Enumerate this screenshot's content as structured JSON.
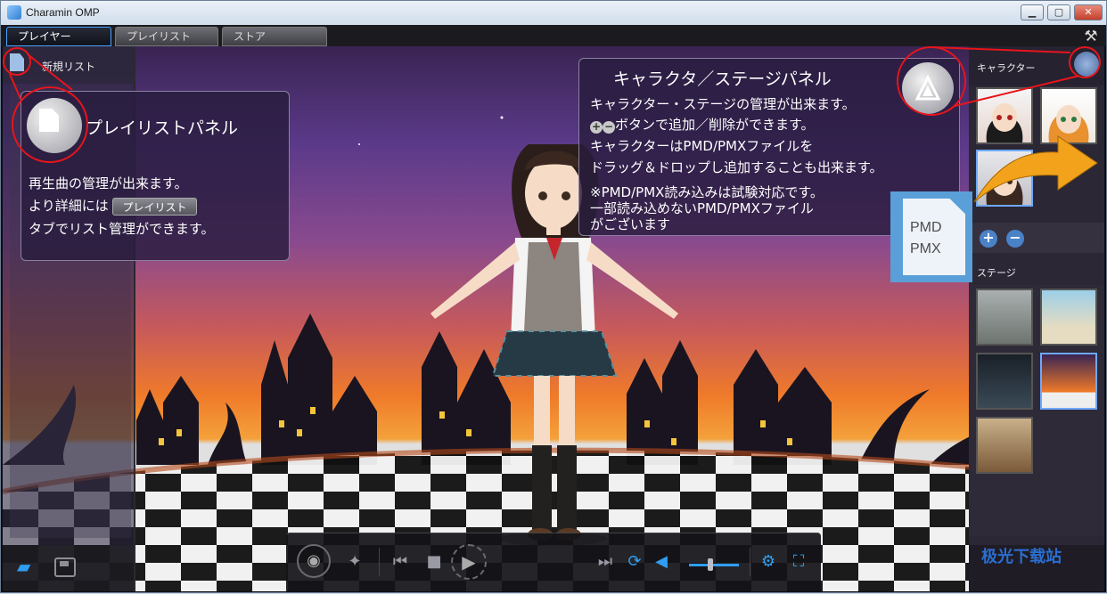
{
  "window": {
    "title": "Charamin OMP",
    "min": "▁",
    "max": "▢",
    "close": "✕"
  },
  "tabs": [
    {
      "label": "プレイヤー"
    },
    {
      "label": "プレイリスト"
    },
    {
      "label": "ストア"
    }
  ],
  "left_panel": {
    "title": "新規リスト"
  },
  "right_panel": {
    "character_title": "キャラクター",
    "stage_title": "ステージ",
    "add": "+",
    "remove": "−"
  },
  "playlist_callout": {
    "title": "プレイリストパネル",
    "line1": "再生曲の管理が出来ます。",
    "line2_pre": "より詳細には",
    "inline_button": "プレイリスト",
    "line3": "タブでリスト管理ができます。"
  },
  "character_callout": {
    "title": "キャラクタ／ステージパネル",
    "line1": "キャラクター・ステージの管理が出来ます。",
    "line2": "ボタンで追加／削除ができます。",
    "line3": "キャラクターはPMD/PMXファイルを",
    "line4": "ドラッグ＆ドロップし追加することも出来ます。",
    "line5": "※PMD/PMX読み込みは試験対応です。",
    "line6": "一部読み込めないPMD/PMXファイル",
    "line7": "がございます"
  },
  "file_badge": {
    "line1": "PMD",
    "line2": "PMX"
  },
  "watermark": "极光下载站",
  "colors": {
    "accent": "#2f9ef2",
    "annotation": "#e8141b",
    "arrow": "#f3a21c"
  }
}
